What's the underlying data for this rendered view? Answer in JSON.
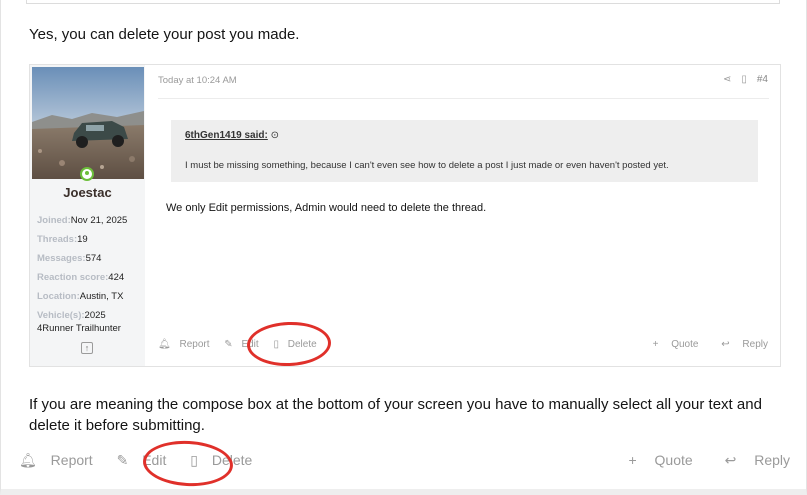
{
  "intro": "Yes, you can delete your post you made.",
  "embedded_post": {
    "user": {
      "name": "Joestac",
      "stats": [
        {
          "key": "Joined:",
          "value": "Nov 21, 2025"
        },
        {
          "key": "Threads:",
          "value": "19"
        },
        {
          "key": "Messages:",
          "value": "574"
        },
        {
          "key": "Reaction score:",
          "value": "424"
        },
        {
          "key": "Location:",
          "value": "Austin, TX"
        },
        {
          "key": "Vehicle(s):",
          "value": "2025"
        }
      ],
      "vehicle_line2": "4Runner Trailhunter",
      "icons": {
        "online": "online-status-icon",
        "share": "share-box-icon"
      }
    },
    "date": "Today at 10:24 AM",
    "number": "#4",
    "quote": {
      "author": "6thGen1419 said:",
      "text": "I must be missing something, because I can't even see how to delete a post I just made or even haven't posted yet."
    },
    "reply": "We only Edit permissions, Admin would need to delete the thread.",
    "actions": {
      "report": "Report",
      "edit": "Edit",
      "delete": "Delete",
      "quote": "Quote",
      "reply": "Reply"
    }
  },
  "body": "If you are meaning the compose box at the bottom of your screen you have to manually select all your text and delete it before submitting.",
  "actions": {
    "report": "Report",
    "edit": "Edit",
    "delete": "Delete",
    "quote": "Quote",
    "reply": "Reply"
  },
  "colors": {
    "annotation": "#e0302a",
    "muted": "#9a9a9a",
    "online": "#6cbf3a"
  }
}
